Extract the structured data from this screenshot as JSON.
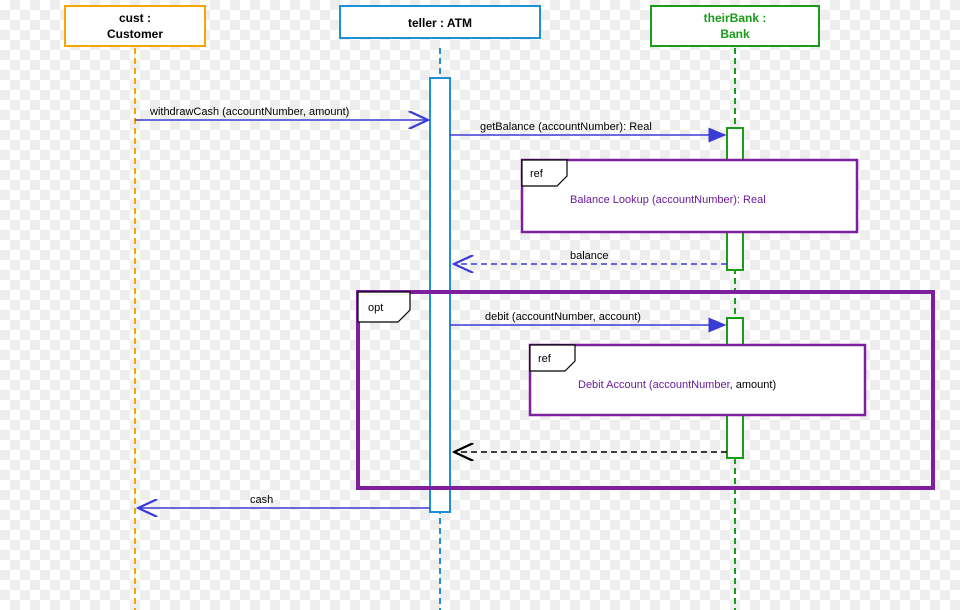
{
  "lifelines": {
    "customer": {
      "name": "cust :",
      "role": "Customer"
    },
    "atm": {
      "name": "teller : ATM",
      "role": ""
    },
    "bank": {
      "name": "theirBank :",
      "role": "Bank"
    }
  },
  "messages": {
    "withdraw": "withdrawCash (accountNumber, amount)",
    "getBalance": "getBalance (accountNumber): Real",
    "balance": "balance",
    "debit": "debit (accountNumber, account)",
    "cash": "cash"
  },
  "refs": {
    "balanceLookup": {
      "label": "ref",
      "title": "Balance  Lookup (accountNumber): Real"
    },
    "debitAccount": {
      "label": "ref",
      "title_a": "Debit Account (accountNumber",
      "title_b": ", amount)"
    }
  },
  "fragments": {
    "opt": "opt"
  },
  "chart_data": {
    "type": "sequence-diagram",
    "lifelines": [
      {
        "id": "cust",
        "label": "cust : Customer",
        "color": "#f7a500"
      },
      {
        "id": "teller",
        "label": "teller : ATM",
        "color": "#1e90d6"
      },
      {
        "id": "theirBank",
        "label": "theirBank : Bank",
        "color": "#1a9c1a"
      }
    ],
    "messages": [
      {
        "from": "cust",
        "to": "teller",
        "text": "withdrawCash (accountNumber, amount)",
        "kind": "sync"
      },
      {
        "from": "teller",
        "to": "theirBank",
        "text": "getBalance (accountNumber): Real",
        "kind": "sync"
      },
      {
        "kind": "ref",
        "over": [
          "teller",
          "theirBank"
        ],
        "text": "Balance Lookup (accountNumber): Real"
      },
      {
        "from": "theirBank",
        "to": "teller",
        "text": "balance",
        "kind": "return"
      },
      {
        "kind": "fragment",
        "type": "opt",
        "contents": [
          {
            "from": "teller",
            "to": "theirBank",
            "text": "debit (accountNumber, account)",
            "kind": "sync"
          },
          {
            "kind": "ref",
            "over": [
              "teller",
              "theirBank"
            ],
            "text": "Debit Account (accountNumber, amount)"
          }
        ]
      },
      {
        "from": "teller",
        "to": "cust",
        "text": "cash",
        "kind": "return"
      }
    ]
  }
}
